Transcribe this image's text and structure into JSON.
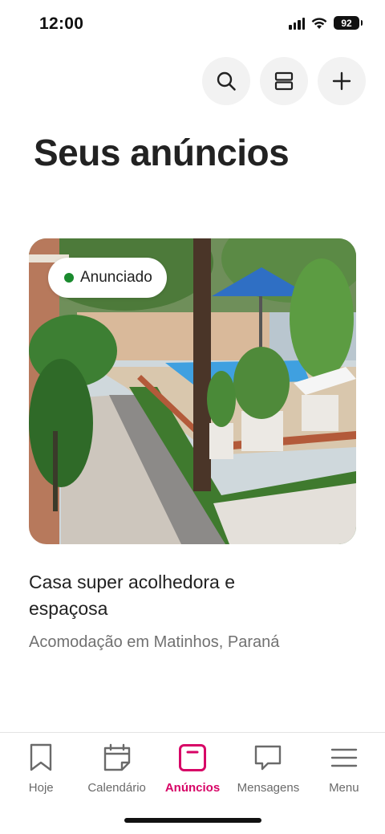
{
  "status_bar": {
    "time": "12:00",
    "battery": "92"
  },
  "top_actions": [
    {
      "name": "search",
      "icon": "search-icon"
    },
    {
      "name": "layout",
      "icon": "layout-icon"
    },
    {
      "name": "add",
      "icon": "plus-icon"
    }
  ],
  "page": {
    "title": "Seus anúncios"
  },
  "listing": {
    "status": "Anunciado",
    "status_color": "#1a8a2e",
    "title": "Casa super acolhedora e espaçosa",
    "subtitle": "Acomodação em Matinhos, Paraná"
  },
  "nav": {
    "accent": "#d70466",
    "items": [
      {
        "label": "Hoje",
        "icon": "bookmark-icon",
        "active": false
      },
      {
        "label": "Calendário",
        "icon": "calendar-icon",
        "active": false
      },
      {
        "label": "Anúncios",
        "icon": "listing-icon",
        "active": true
      },
      {
        "label": "Mensagens",
        "icon": "message-icon",
        "active": false
      },
      {
        "label": "Menu",
        "icon": "menu-icon",
        "active": false
      }
    ]
  }
}
